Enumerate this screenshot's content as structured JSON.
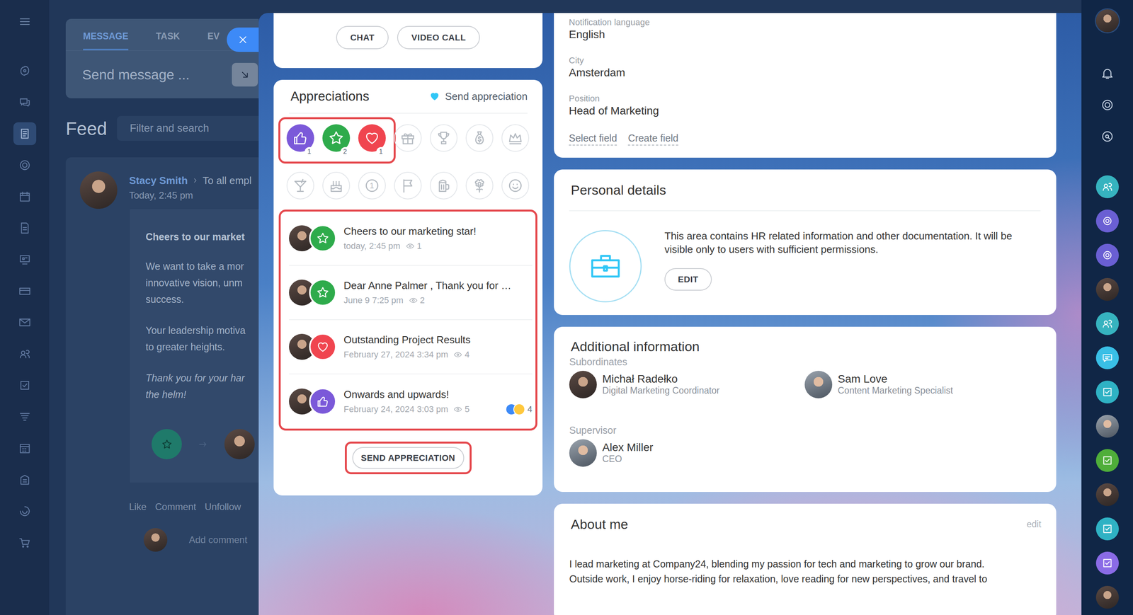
{
  "nav": {
    "items": [
      {
        "selected": false
      },
      {
        "selected": false
      },
      {
        "selected": true
      },
      {
        "selected": false
      },
      {
        "selected": false
      },
      {
        "selected": false
      },
      {
        "selected": false
      },
      {
        "selected": false
      },
      {
        "selected": false
      },
      {
        "selected": false
      },
      {
        "selected": false
      },
      {
        "selected": false
      },
      {
        "selected": false
      },
      {
        "selected": false
      },
      {
        "selected": false
      },
      {
        "selected": false
      }
    ]
  },
  "composer": {
    "tabs": [
      {
        "label": "MESSAGE",
        "selected": true
      },
      {
        "label": "TASK",
        "selected": false
      },
      {
        "label": "EV",
        "selected": false
      }
    ],
    "placeholder": "Send message ..."
  },
  "feed": {
    "title": "Feed",
    "search_placeholder": "Filter and search",
    "post": {
      "author": "Stacy Smith",
      "audience": "To all empl",
      "time": "Today, 2:45 pm",
      "heading": "Cheers to our market",
      "paragraphs": [
        {
          "italic": false,
          "lines": [
            "We want to take a mor",
            "innovative vision, unm",
            "success."
          ]
        },
        {
          "italic": false,
          "lines": [
            "Your leadership motiva",
            "to greater heights."
          ]
        },
        {
          "italic": true,
          "lines": [
            "Thank you for your har",
            "the helm!"
          ]
        }
      ],
      "actions": [
        "Like",
        "Comment",
        "Unfollow"
      ],
      "comment_placeholder": "Add comment"
    }
  },
  "profile_actions": [
    "CHAT",
    "VIDEO CALL"
  ],
  "appreciations": {
    "title": "Appreciations",
    "send_link": "Send appreciation",
    "highlight": {
      "badges": true,
      "list": true,
      "button": true
    },
    "badges": [
      {
        "kind": "like",
        "received": true,
        "color": "#7b59d9",
        "count": "1"
      },
      {
        "kind": "star",
        "received": true,
        "color": "#2eab4b",
        "count": "2"
      },
      {
        "kind": "heart",
        "received": true,
        "color": "#f0454f",
        "count": "1"
      },
      {
        "kind": "gift",
        "received": false
      },
      {
        "kind": "trophy",
        "received": false
      },
      {
        "kind": "money",
        "received": false
      },
      {
        "kind": "crown",
        "received": false
      },
      {
        "kind": "cocktail",
        "received": false
      },
      {
        "kind": "cake",
        "received": false
      },
      {
        "kind": "number",
        "received": false,
        "glyph": "1"
      },
      {
        "kind": "flag",
        "received": false
      },
      {
        "kind": "beer",
        "received": false
      },
      {
        "kind": "flower",
        "received": false
      },
      {
        "kind": "smile",
        "received": false
      }
    ],
    "items": [
      {
        "title": "Cheers to our marketing star!",
        "date": "today, 2:45 pm",
        "views": "1",
        "badge": "star"
      },
      {
        "title": "Dear Anne Palmer , Thank you for …",
        "date": "June 9 7:25 pm",
        "views": "2",
        "badge": "star"
      },
      {
        "title": "Outstanding Project Results",
        "date": "February 27, 2024 3:34 pm",
        "views": "4",
        "badge": "heart"
      },
      {
        "title": "Onwards and upwards!",
        "date": "February 24, 2024 3:03 pm",
        "views": "5",
        "badge": "like",
        "reactions": "4"
      }
    ],
    "button": "SEND APPRECIATION"
  },
  "fields": [
    {
      "label": "Notification language",
      "value": "English"
    },
    {
      "label": "City",
      "value": "Amsterdam"
    },
    {
      "label": "Position",
      "value": "Head of Marketing"
    }
  ],
  "field_links": [
    "Select field",
    "Create field"
  ],
  "personal_details": {
    "title": "Personal details",
    "text": "This area contains HR related information and other documentation. It will be visible only to users with sufficient permissions.",
    "button": "EDIT"
  },
  "additional": {
    "title": "Additional information",
    "groups": [
      {
        "label": "Subordinates",
        "people": [
          {
            "name": "Michał Radełko",
            "role": "Digital Marketing Coordinator"
          },
          {
            "name": "Sam Love",
            "role": "Content Marketing Specialist"
          }
        ]
      },
      {
        "label": "Supervisor",
        "people": [
          {
            "name": "Alex Miller",
            "role": "CEO"
          }
        ]
      }
    ]
  },
  "about": {
    "title": "About me",
    "edit": "edit",
    "lines": [
      "I lead marketing at Company24, blending my passion for tech and marketing to grow our brand.",
      "Outside work, I enjoy horse-riding for relaxation, love reading for new perspectives, and travel to"
    ]
  },
  "rightbar": {
    "chats": [
      {
        "kind": "group",
        "color": "#36b3bf"
      },
      {
        "kind": "copilot",
        "color": "#6a5fd3"
      },
      {
        "kind": "copilot",
        "color": "#6a5fd3"
      },
      {
        "kind": "avatar"
      },
      {
        "kind": "group",
        "color": "#36b3bf"
      },
      {
        "kind": "chat",
        "color": "#39bfe6"
      },
      {
        "kind": "check",
        "color": "#2fb2c4"
      },
      {
        "kind": "avatar"
      },
      {
        "kind": "check",
        "color": "#4fae3a"
      },
      {
        "kind": "avatar"
      },
      {
        "kind": "check",
        "color": "#2fb2c4"
      },
      {
        "kind": "check",
        "color": "#8a6be6"
      },
      {
        "kind": "avatar"
      }
    ]
  }
}
